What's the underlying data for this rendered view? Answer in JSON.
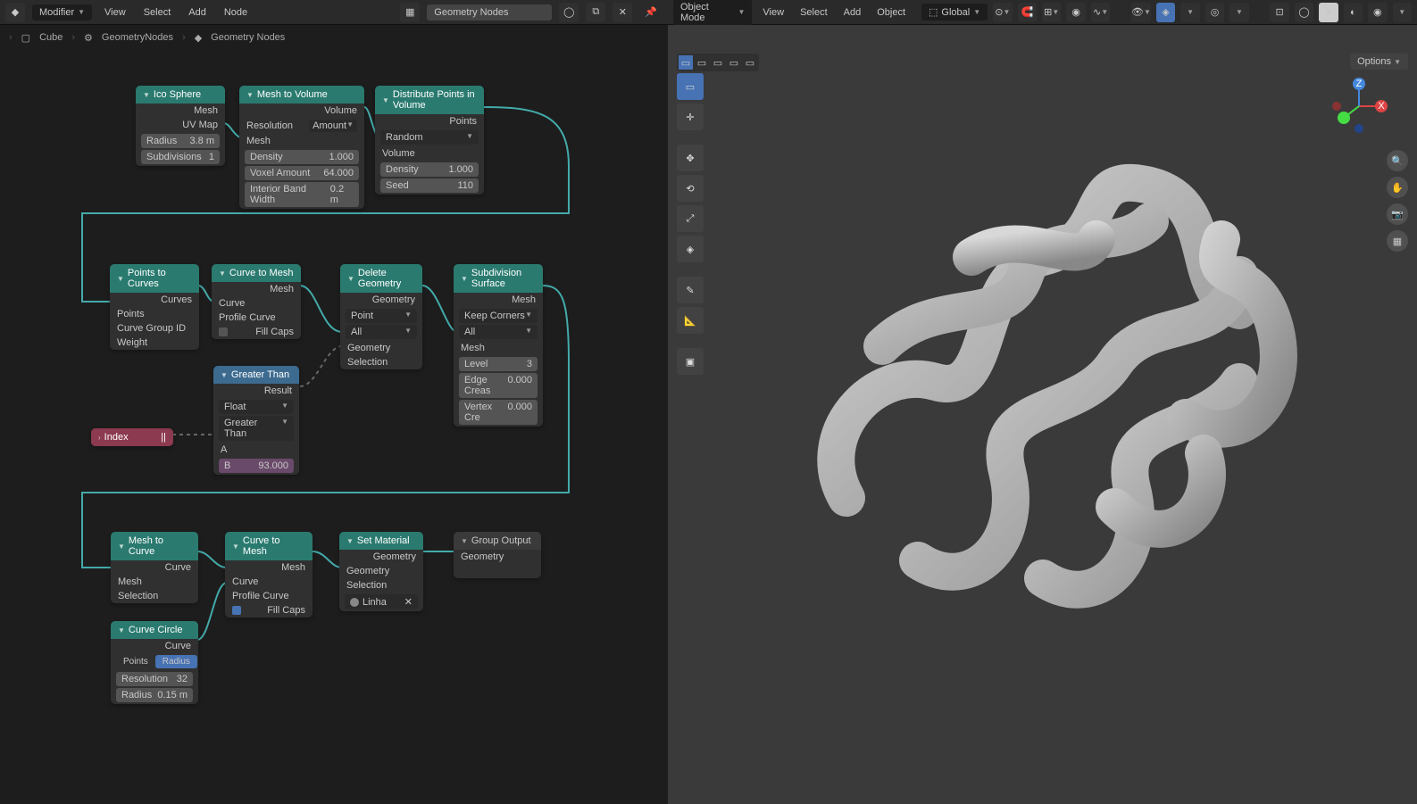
{
  "left_header": {
    "editor_type_icon": "node-editor",
    "modifier_dropdown": "Modifier",
    "menus": [
      "View",
      "Select",
      "Add",
      "Node"
    ],
    "tree_name": "Geometry Nodes",
    "pin": false
  },
  "breadcrumb": [
    "Cube",
    "GeometryNodes",
    "Geometry Nodes"
  ],
  "right_header": {
    "mode": "Object Mode",
    "menus": [
      "View",
      "Select",
      "Add",
      "Object"
    ],
    "orientation": "Global",
    "options_label": "Options"
  },
  "nodes": {
    "ico_sphere": {
      "title": "Ico Sphere",
      "outputs": [
        "Mesh",
        "UV Map"
      ],
      "fields": [
        {
          "label": "Radius",
          "value": "3.8 m"
        },
        {
          "label": "Subdivisions",
          "value": "1"
        }
      ]
    },
    "mesh_to_volume": {
      "title": "Mesh to Volume",
      "outputs": [
        "Volume"
      ],
      "resolution": "Resolution",
      "resolution_mode": "Amount",
      "mesh_label": "Mesh",
      "fields": [
        {
          "label": "Density",
          "value": "1.000"
        },
        {
          "label": "Voxel Amount",
          "value": "64.000"
        },
        {
          "label": "Interior Band Width",
          "value": "0.2 m"
        }
      ]
    },
    "distribute_points": {
      "title": "Distribute Points in Volume",
      "outputs": [
        "Points"
      ],
      "mode": "Random",
      "volume_label": "Volume",
      "fields": [
        {
          "label": "Density",
          "value": "1.000"
        },
        {
          "label": "Seed",
          "value": "110"
        }
      ]
    },
    "points_to_curves": {
      "title": "Points to Curves",
      "outputs": [
        "Curves"
      ],
      "inputs": [
        "Points",
        "Curve Group ID",
        "Weight"
      ]
    },
    "curve_to_mesh_1": {
      "title": "Curve to Mesh",
      "outputs": [
        "Mesh"
      ],
      "inputs": [
        "Curve",
        "Profile Curve"
      ],
      "fill_caps": "Fill Caps"
    },
    "delete_geometry": {
      "title": "Delete Geometry",
      "outputs": [
        "Geometry"
      ],
      "domain": "Point",
      "mode": "All",
      "inputs": [
        "Geometry",
        "Selection"
      ]
    },
    "subdivision": {
      "title": "Subdivision Surface",
      "outputs": [
        "Mesh"
      ],
      "uv_smooth": "Keep Corners",
      "boundary": "All",
      "mesh_label": "Mesh",
      "fields": [
        {
          "label": "Level",
          "value": "3"
        },
        {
          "label": "Edge Creas",
          "value": "0.000"
        },
        {
          "label": "Vertex Cre",
          "value": "0.000"
        }
      ]
    },
    "greater_than": {
      "title": "Greater Than",
      "outputs": [
        "Result"
      ],
      "data_type": "Float",
      "op": "Greater Than",
      "a_label": "A",
      "b_label": "B",
      "b_value": "93.000"
    },
    "index": {
      "title": "Index"
    },
    "mesh_to_curve": {
      "title": "Mesh to Curve",
      "outputs": [
        "Curve"
      ],
      "inputs": [
        "Mesh",
        "Selection"
      ]
    },
    "curve_to_mesh_2": {
      "title": "Curve to Mesh",
      "outputs": [
        "Mesh"
      ],
      "inputs": [
        "Curve",
        "Profile Curve"
      ],
      "fill_caps": "Fill Caps",
      "fill_caps_on": true
    },
    "curve_circle": {
      "title": "Curve Circle",
      "outputs": [
        "Curve"
      ],
      "seg_points": "Points",
      "seg_radius": "Radius",
      "fields": [
        {
          "label": "Resolution",
          "value": "32"
        },
        {
          "label": "Radius",
          "value": "0.15 m"
        }
      ]
    },
    "set_material": {
      "title": "Set Material",
      "outputs": [
        "Geometry"
      ],
      "inputs": [
        "Geometry",
        "Selection"
      ],
      "material": "Linha"
    },
    "group_output": {
      "title": "Group Output",
      "inputs": [
        "Geometry"
      ]
    }
  }
}
